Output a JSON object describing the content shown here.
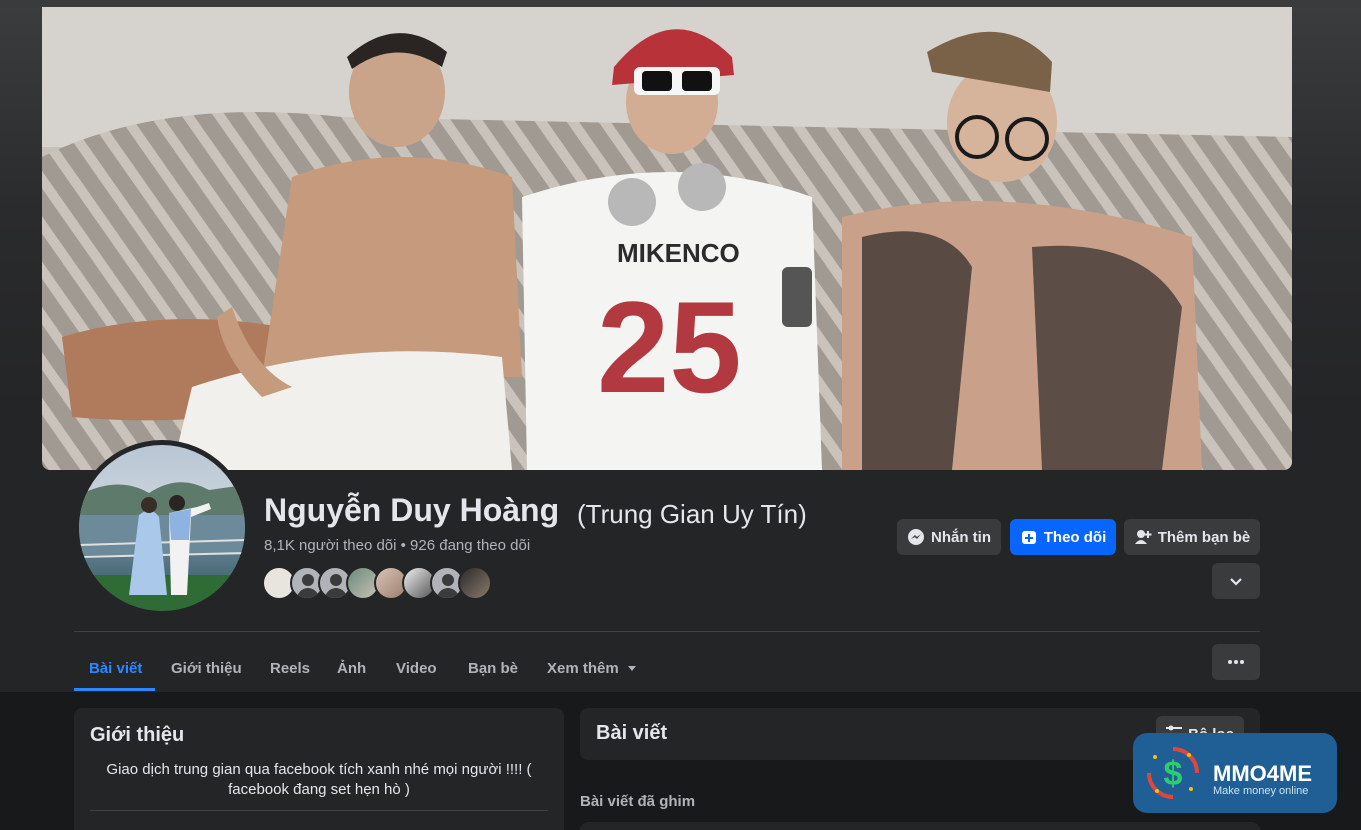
{
  "profile": {
    "name": "Nguyễn Duy Hoàng",
    "alternate_name": "(Trung Gian Uy Tín)",
    "stats": "8,1K người theo dõi • 926 đang theo dõi"
  },
  "actions": {
    "message_label": "Nhắn tin",
    "follow_label": "Theo dõi",
    "add_friend_label": "Thêm bạn bè"
  },
  "tabs": [
    {
      "label": "Bài viết",
      "active": true
    },
    {
      "label": "Giới thiệu"
    },
    {
      "label": "Reels"
    },
    {
      "label": "Ảnh"
    },
    {
      "label": "Video"
    },
    {
      "label": "Bạn bè"
    },
    {
      "label": "Xem thêm"
    }
  ],
  "intro": {
    "title": "Giới thiệu",
    "bio": "Giao dịch trung gian qua facebook tích xanh nhé mọi người !!!! ( facebook đang set hẹn hò )"
  },
  "posts": {
    "title": "Bài viết",
    "filter_label": "Bộ lọc",
    "pinned_label": "Bài viết đã ghim"
  },
  "watermark": {
    "title": "MMO4ME",
    "subtitle": "Make money online",
    "symbol": "$"
  },
  "cover": {
    "jersey_text": "MIKENCO",
    "jersey_number": "25"
  },
  "colors": {
    "accent": "#2d88ff",
    "primary_button": "#0866ff",
    "background": "#18191a",
    "surface": "#242526"
  }
}
